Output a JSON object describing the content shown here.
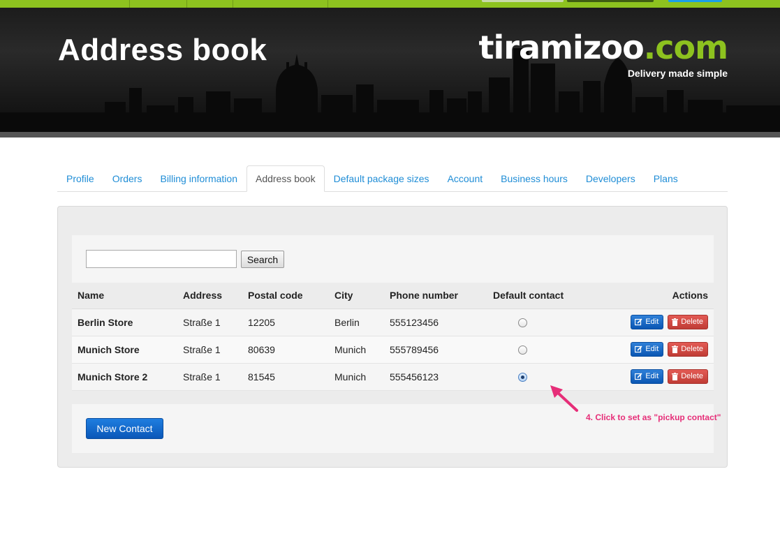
{
  "header": {
    "title": "Address book",
    "brand_white": "tiramizoo",
    "brand_green": ".com",
    "tagline": "Delivery made simple"
  },
  "tabs": [
    {
      "label": "Profile",
      "active": false
    },
    {
      "label": "Orders",
      "active": false
    },
    {
      "label": "Billing information",
      "active": false
    },
    {
      "label": "Address book",
      "active": true
    },
    {
      "label": "Default package sizes",
      "active": false
    },
    {
      "label": "Account",
      "active": false
    },
    {
      "label": "Business hours",
      "active": false
    },
    {
      "label": "Developers",
      "active": false
    },
    {
      "label": "Plans",
      "active": false
    }
  ],
  "search": {
    "value": "",
    "button_label": "Search"
  },
  "table": {
    "headers": {
      "name": "Name",
      "address": "Address",
      "postal_code": "Postal code",
      "city": "City",
      "phone": "Phone number",
      "default": "Default contact",
      "actions": "Actions"
    },
    "rows": [
      {
        "name": "Berlin Store",
        "address": "Straße 1",
        "postal_code": "12205",
        "city": "Berlin",
        "phone": "555123456",
        "default": false
      },
      {
        "name": "Munich Store",
        "address": "Straße 1",
        "postal_code": "80639",
        "city": "Munich",
        "phone": "555789456",
        "default": false
      },
      {
        "name": "Munich Store 2",
        "address": "Straße 1",
        "postal_code": "81545",
        "city": "Munich",
        "phone": "555456123",
        "default": true
      }
    ],
    "edit_label": "Edit",
    "delete_label": "Delete"
  },
  "new_contact_label": "New Contact",
  "annotation": "4. Click to set as \"pickup contact\"",
  "colors": {
    "brand_green": "#8dc21f",
    "link_blue": "#1f8dd6",
    "primary_blue": "#0a57b8",
    "danger_red": "#c03c35",
    "annotation_pink": "#e62e78"
  }
}
